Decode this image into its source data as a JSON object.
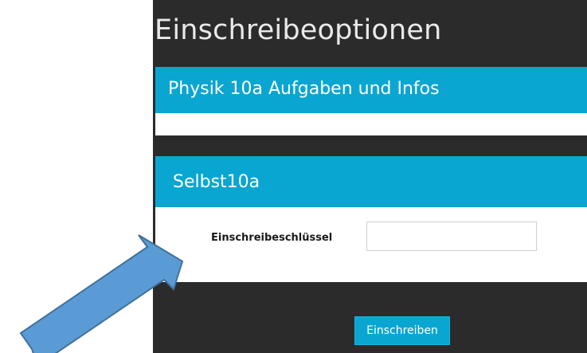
{
  "page": {
    "title": "Einschreibeoptionen"
  },
  "course": {
    "title": "Physik 10a Aufgaben und Infos"
  },
  "enrolment_method": {
    "title": "Selbst10a",
    "key_label": "Einschreibeschlüssel",
    "key_value": "",
    "submit_label": "Einschreiben"
  },
  "annotation": {
    "icon": "arrow-icon",
    "color": "#5b9bd5"
  },
  "colors": {
    "panel_background": "#2b2b2b",
    "accent": "#0aa6d2",
    "title_text": "#e9e9e9"
  }
}
